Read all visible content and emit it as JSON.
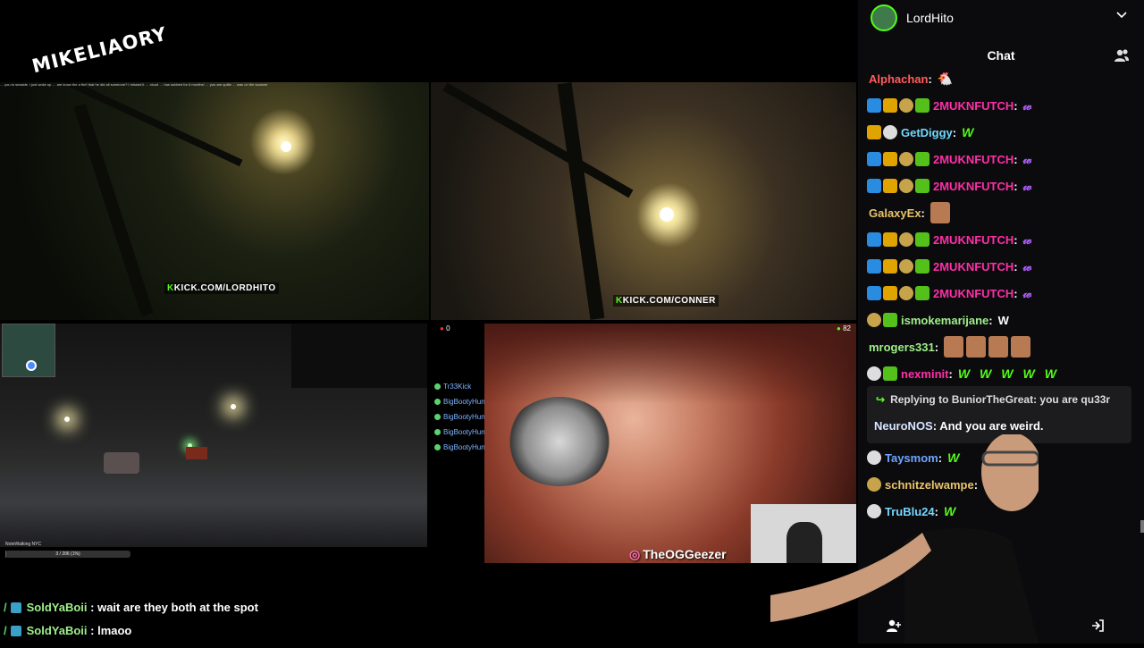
{
  "logo": {
    "text": "MIKELIAORY"
  },
  "stream": {
    "ticker_text": "… you to seaside. i just woke up … are know the a the! that he did all someone? I missed it … cloud … has subbed for 6 months! … you are quilte … was on the scanner",
    "kick_tag_left": "KICK.COM/LORDHITO",
    "kick_tag_right": "KICK.COM/CONNER",
    "nw_label": "NoteWalking NYC",
    "progress_text": "3 / 206 (1%)",
    "progress_fraction": 0.01,
    "red_counter": "0",
    "green_counter": "82",
    "geezer_name": "TheOGGeezer",
    "mini_chat": [
      {
        "name": "Tr33Kick"
      },
      {
        "name": "BigBootyHunter"
      },
      {
        "name": "BigBootyHunter"
      },
      {
        "name": "BigBootyHunter"
      },
      {
        "name": "BigBootyHunter"
      }
    ]
  },
  "overlay_chat": [
    {
      "user": "SoldYaBoii",
      "sep": " : ",
      "msg": "wait are they both at the spot"
    },
    {
      "user": "SoldYaBoii",
      "sep": " : ",
      "msg": "lmaoo"
    }
  ],
  "chat": {
    "account_name": "LordHito",
    "title": "Chat",
    "messages": [
      {
        "badges": [],
        "user": "Alphachan",
        "color": "#ff5c5c",
        "content_type": "emote",
        "content": "🐔"
      },
      {
        "badges": [
          "mod",
          "vip",
          "og",
          "gift"
        ],
        "user": "2MUKNFUTCH",
        "color": "#ff2fa8",
        "content_type": "emote-purple",
        "content": "𝓌"
      },
      {
        "badges": [
          "vip",
          "star"
        ],
        "user": "GetDiggy",
        "color": "#74d7ff",
        "content_type": "emote-green",
        "content": "W"
      },
      {
        "badges": [
          "mod",
          "vip",
          "og",
          "gift"
        ],
        "user": "2MUKNFUTCH",
        "color": "#ff2fa8",
        "content_type": "emote-purple",
        "content": "𝓌"
      },
      {
        "badges": [
          "mod",
          "vip",
          "og",
          "gift"
        ],
        "user": "2MUKNFUTCH",
        "color": "#ff2fa8",
        "content_type": "emote-purple",
        "content": "𝓌"
      },
      {
        "badges": [],
        "user": "GalaxyEx",
        "color": "#e8c46a",
        "content_type": "face",
        "content": ""
      },
      {
        "badges": [
          "mod",
          "vip",
          "og",
          "gift"
        ],
        "user": "2MUKNFUTCH",
        "color": "#ff2fa8",
        "content_type": "emote-purple",
        "content": "𝓌"
      },
      {
        "badges": [
          "mod",
          "vip",
          "og",
          "gift"
        ],
        "user": "2MUKNFUTCH",
        "color": "#ff2fa8",
        "content_type": "emote-purple",
        "content": "𝓌"
      },
      {
        "badges": [
          "mod",
          "vip",
          "og",
          "gift"
        ],
        "user": "2MUKNFUTCH",
        "color": "#ff2fa8",
        "content_type": "emote-purple",
        "content": "𝓌"
      },
      {
        "badges": [
          "og",
          "gift"
        ],
        "user": "ismokemarijane",
        "color": "#9ff08a",
        "content_type": "text",
        "content": "W"
      },
      {
        "badges": [],
        "user": "mrogers331",
        "color": "#9ff08a",
        "content_type": "faces",
        "content": ""
      },
      {
        "badges": [
          "star",
          "gift"
        ],
        "user": "nexminit",
        "color": "#ff2fa8",
        "content_type": "emote-green-multi",
        "content": "W"
      }
    ],
    "reply": {
      "replying_label": "Replying to BuniorTheGreat: you are qu33r",
      "user": "NeuroNOS",
      "msg": "And you are weird."
    },
    "after_reply": [
      {
        "badges": [
          "star"
        ],
        "user": "Taysmom",
        "color": "#6fa4ff",
        "content": "W"
      },
      {
        "badges": [
          "og"
        ],
        "user": "schnitzelwampe",
        "color": "#e8c46a",
        "content": ""
      },
      {
        "badges": [
          "star"
        ],
        "user": "TruBlu24",
        "color": "#74d7ff",
        "content": "W"
      }
    ]
  }
}
